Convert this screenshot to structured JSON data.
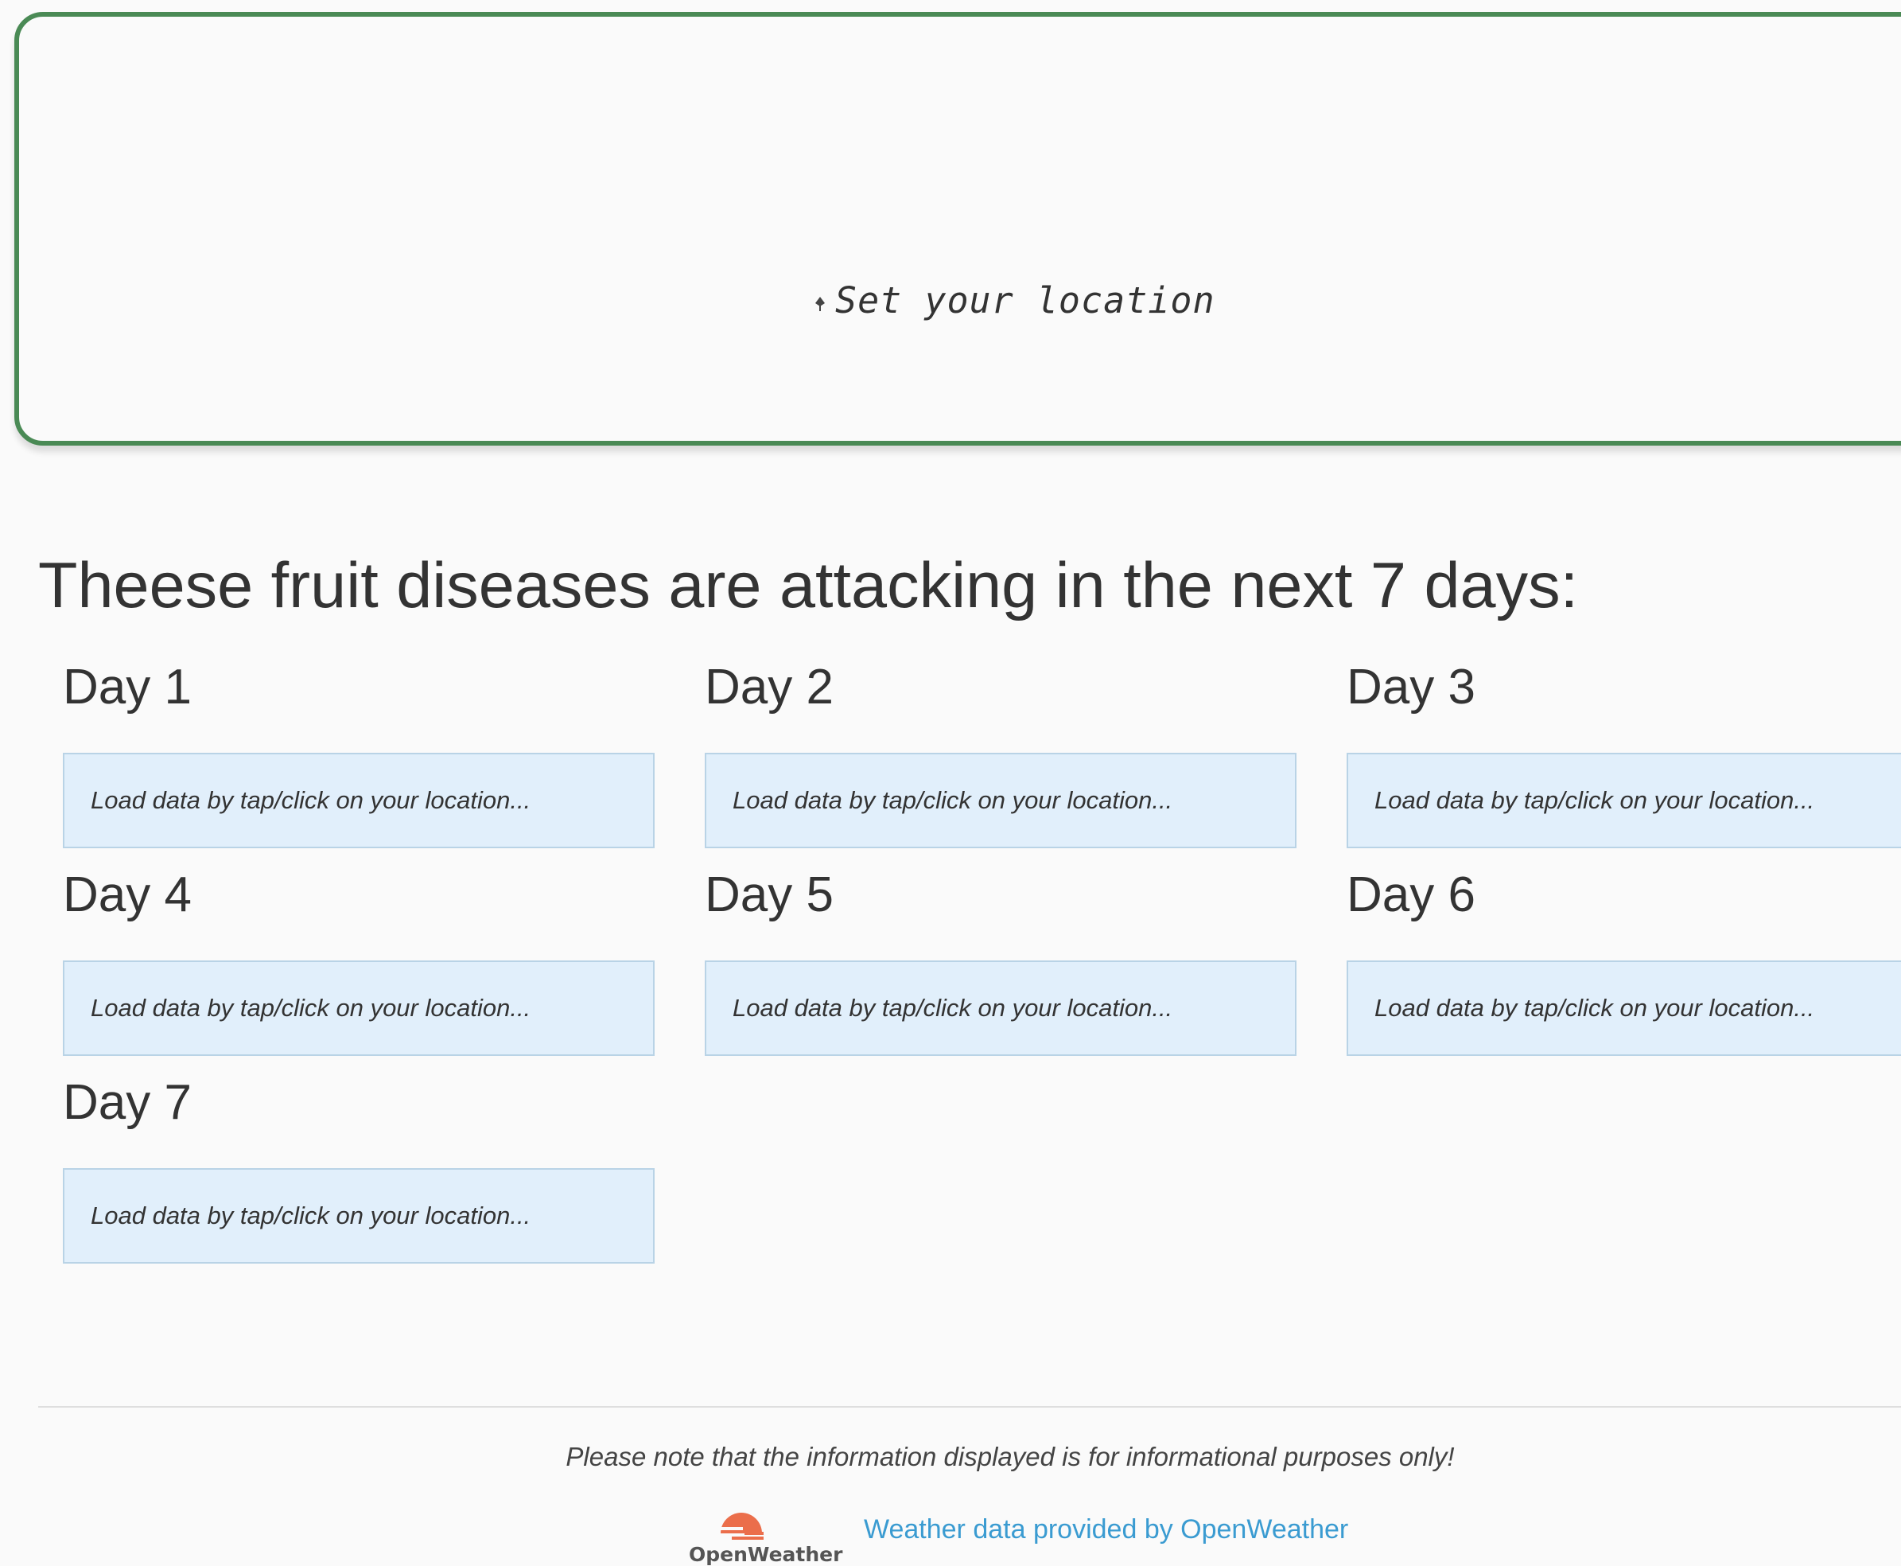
{
  "location": {
    "icon": "pin-icon",
    "label": "Set your location"
  },
  "headline": "Theese fruit diseases are attacking in the next 7 days:",
  "days": [
    {
      "title": "Day 1",
      "message": "Load data by tap/click on your location..."
    },
    {
      "title": "Day 2",
      "message": "Load data by tap/click on your location..."
    },
    {
      "title": "Day 3",
      "message": "Load data by tap/click on your location..."
    },
    {
      "title": "Day 4",
      "message": "Load data by tap/click on your location..."
    },
    {
      "title": "Day 5",
      "message": "Load data by tap/click on your location..."
    },
    {
      "title": "Day 6",
      "message": "Load data by tap/click on your location..."
    },
    {
      "title": "Day 7",
      "message": "Load data by tap/click on your location..."
    }
  ],
  "footer": {
    "disclaimer": "Please note that the information displayed is for informational purposes only!",
    "logo_text": "OpenWeather",
    "attribution": "Weather data provided by OpenWeather"
  },
  "colors": {
    "panel_border": "#4a8a55",
    "day_box_bg": "#e1effb",
    "link": "#3a9bd1",
    "logo": "#eb6e4b"
  }
}
